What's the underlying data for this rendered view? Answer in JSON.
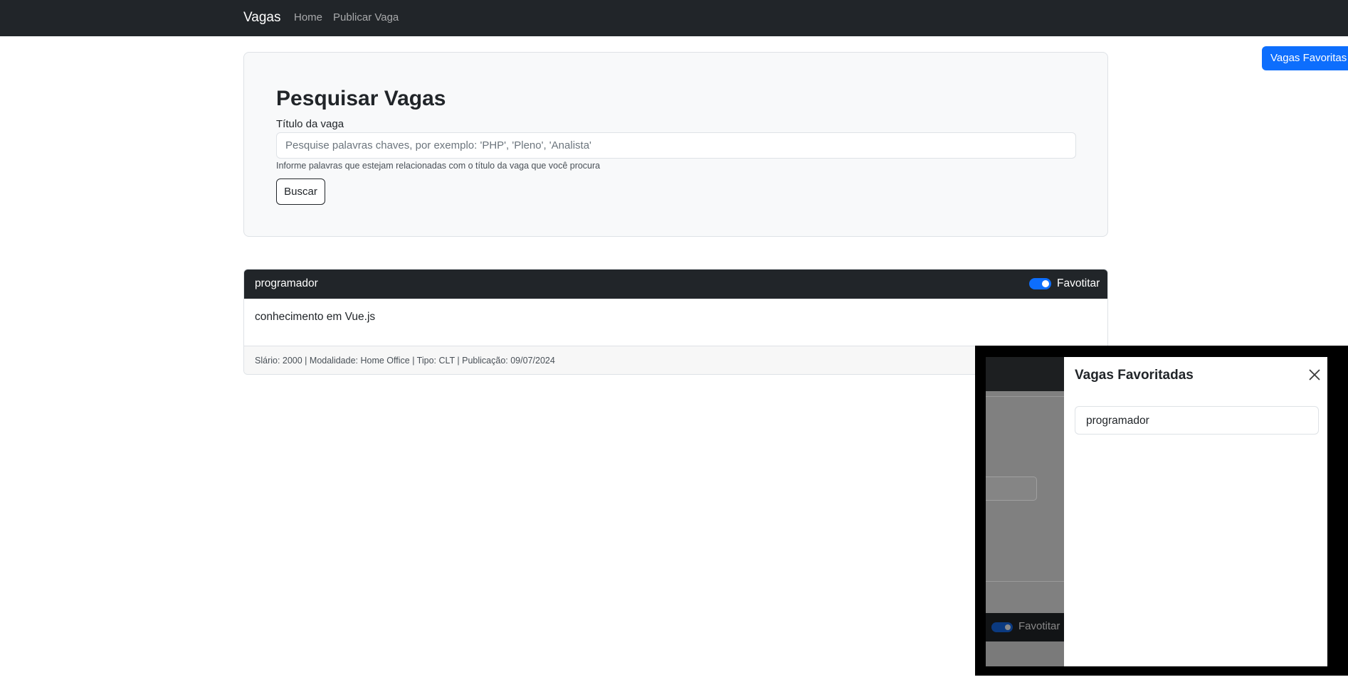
{
  "navbar": {
    "brand": "Vagas",
    "links": [
      "Home",
      "Publicar Vaga"
    ]
  },
  "favorites_button": "Vagas Favoritas",
  "search": {
    "title": "Pesquisar Vagas",
    "label": "Título da vaga",
    "placeholder": "Pesquise palavras chaves, por exemplo: 'PHP', 'Pleno', 'Analista'",
    "help": "Informe palavras que estejam relacionadas com o título da vaga que você procura",
    "button": "Buscar"
  },
  "job": {
    "title": "programador",
    "favorite_label": "Favotitar",
    "favorited": true,
    "description": "conhecimento em Vue.js",
    "meta": "Slário: 2000 | Modalidade: Home Office | Tipo: CLT | Publicação: 09/07/2024"
  },
  "offcanvas": {
    "title": "Vagas Favoritadas",
    "items": [
      "programador"
    ],
    "background_favorite_label": "Favotitar"
  },
  "colors": {
    "navbar": "#212529",
    "primary": "#0d6efd",
    "panel": "#f8f9fa"
  }
}
